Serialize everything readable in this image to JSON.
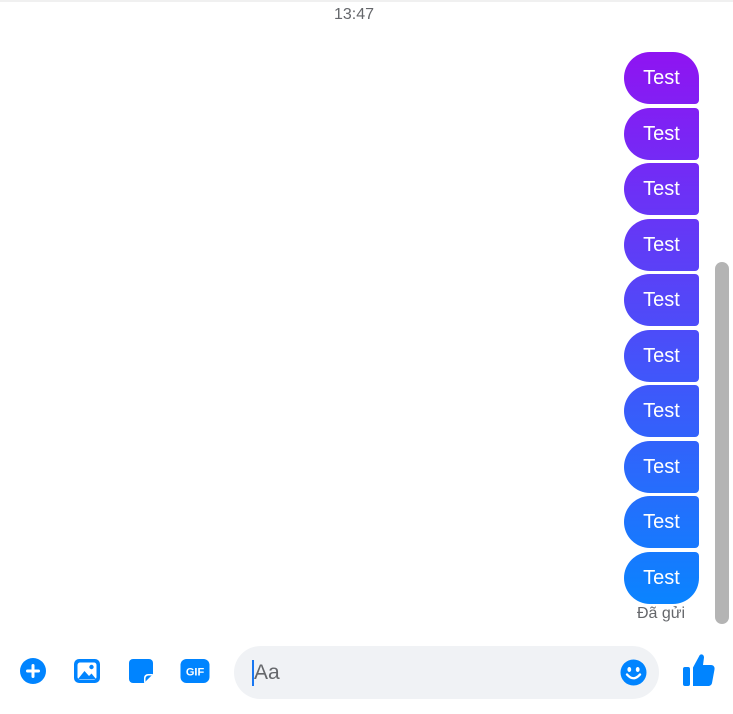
{
  "thread": {
    "timestamp": "13:47",
    "messages": [
      {
        "text": "Test"
      },
      {
        "text": "Test"
      },
      {
        "text": "Test"
      },
      {
        "text": "Test"
      },
      {
        "text": "Test"
      },
      {
        "text": "Test"
      },
      {
        "text": "Test"
      },
      {
        "text": "Test"
      },
      {
        "text": "Test"
      },
      {
        "text": "Test"
      }
    ],
    "status": "Đã gửi",
    "bubble_gradient": [
      "#8f14f2",
      "#0a84ff"
    ]
  },
  "composer": {
    "placeholder": "Aa",
    "value": "",
    "gif_label": "GIF",
    "icons": [
      "add-circle-icon",
      "image-icon",
      "sticker-icon",
      "gif-icon",
      "emoji-icon",
      "thumbs-up-icon"
    ],
    "accent": "#0084ff",
    "input_background": "#f0f2f5"
  },
  "scrollbar": {
    "thumb_color": "#b4b4b4"
  }
}
